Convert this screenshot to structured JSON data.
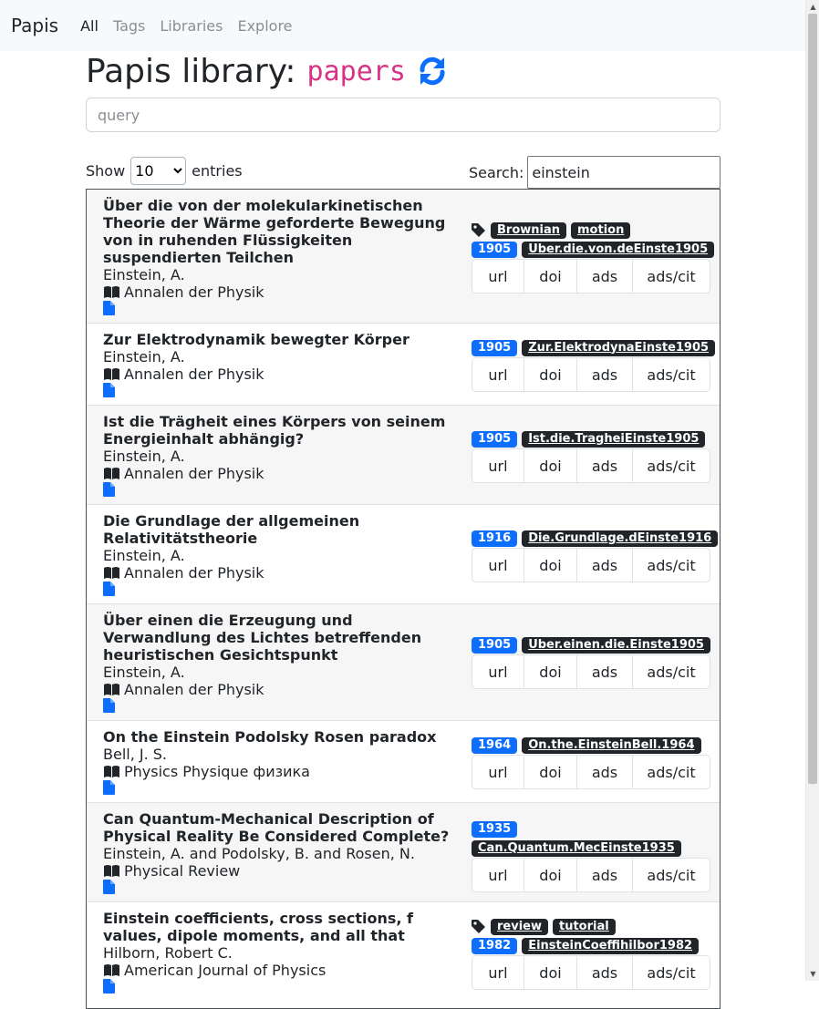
{
  "nav": {
    "brand": "Papis",
    "links": [
      {
        "label": "All",
        "active": true
      },
      {
        "label": "Tags",
        "active": false
      },
      {
        "label": "Libraries",
        "active": false
      },
      {
        "label": "Explore",
        "active": false
      }
    ]
  },
  "header": {
    "title": "Papis library:",
    "library": "papers",
    "refresh_icon": "refresh-icon"
  },
  "query": {
    "placeholder": "query",
    "value": ""
  },
  "controls": {
    "show_label": "Show",
    "entries_value": "10",
    "entries_label": "entries",
    "search_label": "Search:",
    "search_value": "einstein"
  },
  "buttons": {
    "url": "url",
    "doi": "doi",
    "ads": "ads",
    "ads_cit": "ads/cit"
  },
  "colors": {
    "primary": "#0d6efd",
    "dark": "#212529",
    "library": "#d63384"
  },
  "papers": [
    {
      "title": "Über die von der molekularkinetischen Theorie der Wärme geforderte Bewegung von in ruhenden Flüssigkeiten suspendierten Teilchen",
      "authors": "Einstein, A.",
      "journal": "Annalen der Physik",
      "tags": [
        "Brownian",
        "motion"
      ],
      "year": "1905",
      "ref": "Uber.die.von.deEinste1905"
    },
    {
      "title": "Zur Elektrodynamik bewegter Körper",
      "authors": "Einstein, A.",
      "journal": "Annalen der Physik",
      "tags": [],
      "year": "1905",
      "ref": "Zur.ElektrodynaEinste1905"
    },
    {
      "title": "Ist die Trägheit eines Körpers von seinem Energieinhalt abhängig?",
      "authors": "Einstein, A.",
      "journal": "Annalen der Physik",
      "tags": [],
      "year": "1905",
      "ref": "Ist.die.TragheiEinste1905"
    },
    {
      "title": "Die Grundlage der allgemeinen Relativitätstheorie",
      "authors": "Einstein, A.",
      "journal": "Annalen der Physik",
      "tags": [],
      "year": "1916",
      "ref": "Die.Grundlage.dEinste1916"
    },
    {
      "title": "Über einen die Erzeugung und Verwandlung des Lichtes betreffenden heuristischen Gesichtspunkt",
      "authors": "Einstein, A.",
      "journal": "Annalen der Physik",
      "tags": [],
      "year": "1905",
      "ref": "Uber.einen.die.Einste1905"
    },
    {
      "title": "On the Einstein Podolsky Rosen paradox",
      "authors": "Bell, J. S.",
      "journal": "Physics Physique физика",
      "tags": [],
      "year": "1964",
      "ref": "On.the.EinsteinBell.1964"
    },
    {
      "title": "Can Quantum-Mechanical Description of Physical Reality Be Considered Complete?",
      "authors": "Einstein, A. and Podolsky, B. and Rosen, N.",
      "journal": "Physical Review",
      "tags": [],
      "year": "1935",
      "ref": "Can.Quantum.MecEinste1935"
    },
    {
      "title": "Einstein coefficients, cross sections, f values, dipole moments, and all that",
      "authors": "Hilborn, Robert C.",
      "journal": "American Journal of Physics",
      "tags": [
        "review",
        "tutorial"
      ],
      "year": "1982",
      "ref": "EinsteinCoeffihilbor1982"
    }
  ]
}
